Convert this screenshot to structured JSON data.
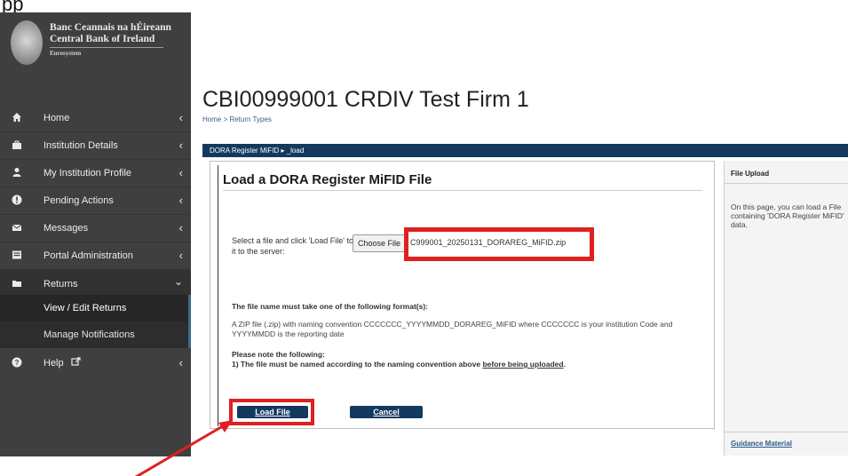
{
  "cutoff_text": "pp",
  "brand": {
    "line1": "Banc Ceannais na hÉireann",
    "line2": "Central Bank of Ireland",
    "line3": "Eurosystem",
    "logo_icon": "cbi-seal-logo"
  },
  "sidebar": {
    "items": [
      {
        "label": "Home",
        "icon": "home-icon"
      },
      {
        "label": "Institution Details",
        "icon": "briefcase-icon"
      },
      {
        "label": "My Institution Profile",
        "icon": "user-icon"
      },
      {
        "label": "Pending Actions",
        "icon": "alert-circle-icon"
      },
      {
        "label": "Messages",
        "icon": "envelope-icon"
      },
      {
        "label": "Portal Administration",
        "icon": "admin-icon"
      },
      {
        "label": "Returns",
        "icon": "folder-open-icon"
      },
      {
        "label": "Help",
        "icon": "question-circle-icon"
      }
    ],
    "returns_sub": [
      {
        "label": "View / Edit Returns"
      },
      {
        "label": "Manage Notifications"
      }
    ]
  },
  "page": {
    "title": "CBI00999001 CRDIV Test Firm 1",
    "breadcrumb": "Home > Return Types"
  },
  "dark_bar": {
    "text": "DORA Register MiFID ▸ _load"
  },
  "panel": {
    "heading": "Load a DORA Register MiFID File",
    "select_text": "Select a file and click 'Load File' to load it to the server:",
    "choose_button": "Choose File",
    "file_name": "C999001_20250131_DORAREG_MiFID.zip",
    "format_head": "The file name must take one of the following format(s):",
    "format_body": "A ZIP file (.zip) with naming convention CCCCCCC_YYYYMMDD_DORAREG_MiFID where CCCCCCC is your institution Code and YYYYMMDD is the reporting date",
    "note_head": "Please note the following:",
    "note_body_start": "1) The file must be named according to the naming convention above ",
    "note_body_link": "before being uploaded",
    "note_body_end": ".",
    "load_button": "Load File",
    "cancel_button": "Cancel"
  },
  "side_panel": {
    "title": "File Upload",
    "text": "On this page, you can load a File containing 'DORA Register MiFID' data.",
    "link": "Guidance Material"
  },
  "colors": {
    "sidebar": "#3f3f3f",
    "navy": "#14395f",
    "highlight": "#e02020"
  }
}
